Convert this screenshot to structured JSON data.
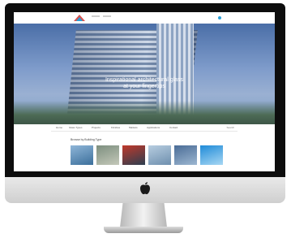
{
  "hero": {
    "line1": "Inspirational architectural glass",
    "line2": "at your fingertips"
  },
  "nav": {
    "items": [
      "Home",
      "Glass Types",
      "Projects",
      "Finishes",
      "Markets",
      "Applications",
      "Contact"
    ],
    "search": "Search"
  },
  "section": {
    "title": "Browse by Building Type"
  },
  "device": {
    "logo_icon": "apple-logo-icon",
    "accent": "#2aa0d8"
  }
}
